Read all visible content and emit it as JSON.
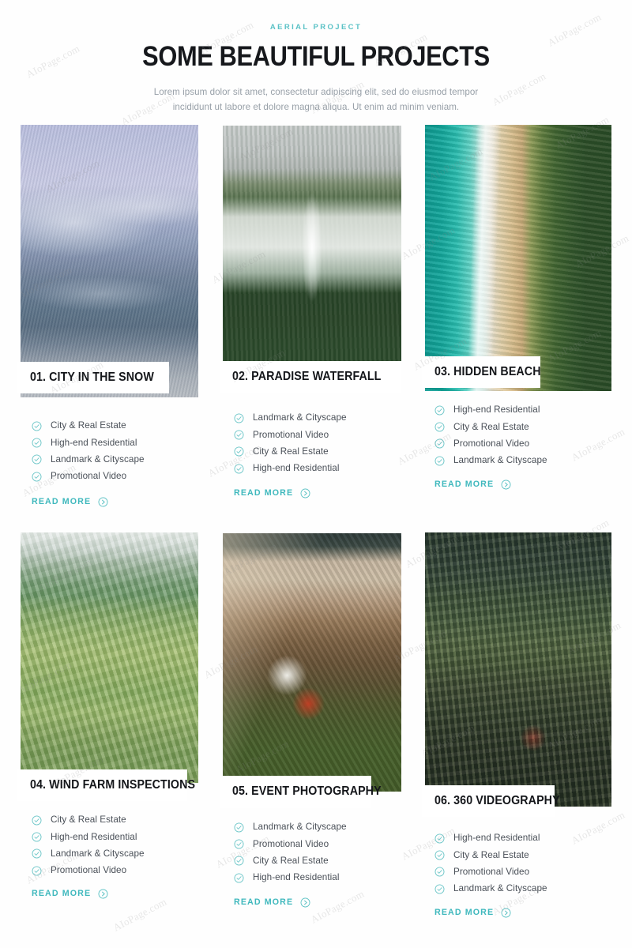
{
  "header": {
    "eyebrow": "AERIAL PROJECT",
    "title": "Some Beautiful Projects",
    "subtitle": "Lorem ipsum dolor sit amet, consectetur adipiscing elit, sed do eiusmod tempor incididunt ut labore et dolore magna aliqua. Ut enim ad minim veniam."
  },
  "theme": {
    "accent": "#3fb8bd",
    "eyebrow_color": "#5bc2c6",
    "heading_color": "#16181c",
    "body_color": "#98a0a8",
    "feature_text_color": "#4a5058",
    "background": "#fefefe"
  },
  "read_more_label": "Read More",
  "icons": {
    "check": "circle-check-icon",
    "arrow": "circle-arrow-right-icon"
  },
  "watermark": {
    "text": "AIoPage.com"
  },
  "projects": [
    {
      "number": "01.",
      "title": "01. City in the Snow",
      "image_alt": "aerial-view-snow-covered-coastal-city-with-bridge",
      "features": [
        "City & Real Estate",
        "High-end Residential",
        "Landmark & Cityscape",
        "Promotional Video"
      ],
      "read_more": "Read More"
    },
    {
      "number": "02.",
      "title": "02. Paradise Waterfall",
      "image_alt": "aerial-view-waterfall-in-green-valley",
      "features": [
        "Landmark & Cityscape",
        "Promotional Video",
        "City & Real Estate",
        "High-end Residential"
      ],
      "read_more": "Read More"
    },
    {
      "number": "03.",
      "title": "03. Hidden Beach",
      "image_alt": "aerial-view-turquoise-sea-sand-beach-and-forest",
      "features": [
        "High-end Residential",
        "City & Real Estate",
        "Promotional Video",
        "Landmark & Cityscape"
      ],
      "read_more": "Read More"
    },
    {
      "number": "04.",
      "title": "04. Wind Farm Inspections",
      "image_alt": "aerial-view-terraced-rice-fields-and-village",
      "features": [
        "City & Real Estate",
        "High-end Residential",
        "Landmark & Cityscape",
        "Promotional Video"
      ],
      "read_more": "Read More"
    },
    {
      "number": "05.",
      "title": "05. Event Photography",
      "image_alt": "aerial-view-boats-on-shore-with-trees",
      "features": [
        "Landmark & Cityscape",
        "Promotional Video",
        "City & Real Estate",
        "High-end Residential"
      ],
      "read_more": "Read More"
    },
    {
      "number": "06.",
      "title": "06. 360 Videography",
      "image_alt": "aerial-view-dense-forest-with-rocky-outcrop",
      "features": [
        "High-end Residential",
        "City & Real Estate",
        "Promotional Video",
        "Landmark & Cityscape"
      ],
      "read_more": "Read More"
    }
  ]
}
